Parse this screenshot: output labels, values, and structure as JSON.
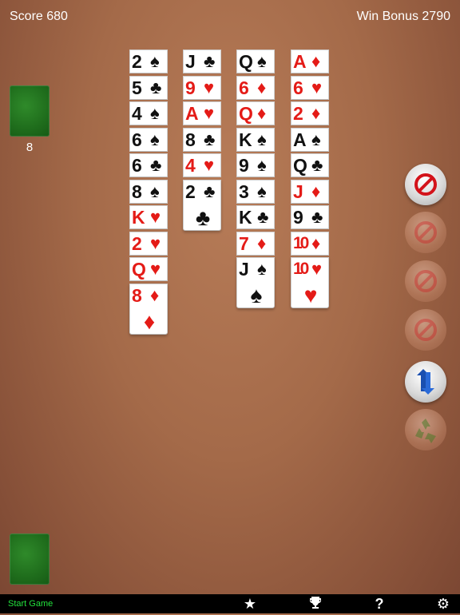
{
  "header": {
    "score": "Score 680",
    "win_bonus": "Win Bonus 2790"
  },
  "stock": {
    "count": "8"
  },
  "tableau": [
    {
      "cards": [
        {
          "rank": "2",
          "suit": "♠",
          "color": "black"
        },
        {
          "rank": "5",
          "suit": "♣",
          "color": "black"
        },
        {
          "rank": "4",
          "suit": "♠",
          "color": "black"
        },
        {
          "rank": "6",
          "suit": "♠",
          "color": "black"
        },
        {
          "rank": "6",
          "suit": "♣",
          "color": "black"
        },
        {
          "rank": "8",
          "suit": "♠",
          "color": "black"
        },
        {
          "rank": "K",
          "suit": "♥",
          "color": "red"
        },
        {
          "rank": "2",
          "suit": "♥",
          "color": "red"
        },
        {
          "rank": "Q",
          "suit": "♥",
          "color": "red"
        },
        {
          "rank": "8",
          "suit": "♦",
          "color": "red"
        }
      ]
    },
    {
      "cards": [
        {
          "rank": "J",
          "suit": "♣",
          "color": "black"
        },
        {
          "rank": "9",
          "suit": "♥",
          "color": "red"
        },
        {
          "rank": "A",
          "suit": "♥",
          "color": "red"
        },
        {
          "rank": "8",
          "suit": "♣",
          "color": "black"
        },
        {
          "rank": "4",
          "suit": "♥",
          "color": "red"
        },
        {
          "rank": "2",
          "suit": "♣",
          "color": "black"
        }
      ]
    },
    {
      "cards": [
        {
          "rank": "Q",
          "suit": "♠",
          "color": "black"
        },
        {
          "rank": "6",
          "suit": "♦",
          "color": "red"
        },
        {
          "rank": "Q",
          "suit": "♦",
          "color": "red"
        },
        {
          "rank": "K",
          "suit": "♠",
          "color": "black"
        },
        {
          "rank": "9",
          "suit": "♠",
          "color": "black"
        },
        {
          "rank": "3",
          "suit": "♠",
          "color": "black"
        },
        {
          "rank": "K",
          "suit": "♣",
          "color": "black"
        },
        {
          "rank": "7",
          "suit": "♦",
          "color": "red"
        },
        {
          "rank": "J",
          "suit": "♠",
          "color": "black"
        }
      ]
    },
    {
      "cards": [
        {
          "rank": "A",
          "suit": "♦",
          "color": "red"
        },
        {
          "rank": "6",
          "suit": "♥",
          "color": "red"
        },
        {
          "rank": "2",
          "suit": "♦",
          "color": "red"
        },
        {
          "rank": "A",
          "suit": "♠",
          "color": "black"
        },
        {
          "rank": "Q",
          "suit": "♣",
          "color": "black"
        },
        {
          "rank": "J",
          "suit": "♦",
          "color": "red"
        },
        {
          "rank": "9",
          "suit": "♣",
          "color": "black"
        },
        {
          "rank": "10",
          "suit": "♦",
          "color": "red"
        },
        {
          "rank": "10",
          "suit": "♥",
          "color": "red"
        }
      ]
    }
  ],
  "side_buttons": [
    {
      "name": "no-move-button-1",
      "icon": "prohibited-icon",
      "state": "active"
    },
    {
      "name": "no-move-button-2",
      "icon": "prohibited-icon",
      "state": "dim"
    },
    {
      "name": "no-move-button-3",
      "icon": "prohibited-icon",
      "state": "dim"
    },
    {
      "name": "no-move-button-4",
      "icon": "prohibited-icon",
      "state": "dim"
    },
    {
      "name": "undo-button",
      "icon": "undo-arrows-icon",
      "state": "active"
    },
    {
      "name": "recycle-button",
      "icon": "recycle-icon",
      "state": "dim"
    }
  ],
  "bottom_bar": {
    "start_game": "Start Game",
    "icons": [
      "star-icon",
      "trophy-icon",
      "help-icon",
      "gear-icon"
    ],
    "glyphs": {
      "star": "★",
      "trophy": "🏆",
      "help": "?",
      "gear": "⚙"
    }
  },
  "colors": {
    "red_suit": "#e41b17",
    "felt_green": "#1f6d1c",
    "start_game_green": "#22e03c"
  }
}
